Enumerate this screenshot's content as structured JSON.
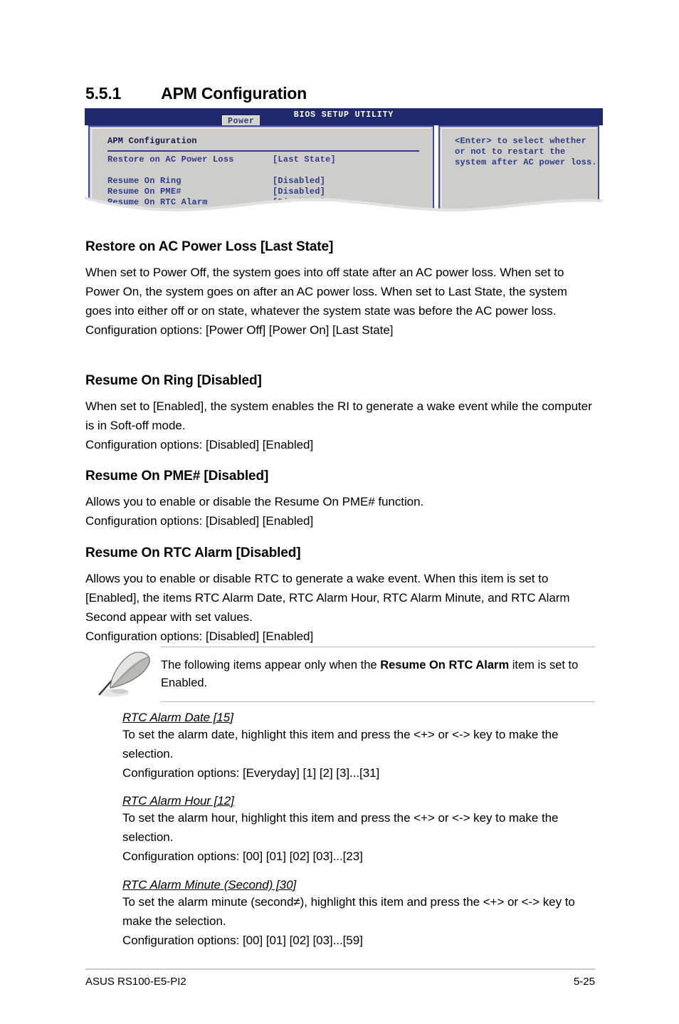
{
  "section": {
    "number": "5.5.1",
    "title": "APM Configuration"
  },
  "bios": {
    "title": "BIOS SETUP UTILITY",
    "tab": "Power",
    "panel_heading": "APM Configuration",
    "colors": {
      "header_blue": "#1f2a6e",
      "text_blue": "#2c3c8c",
      "panel_gray": "#cfcdca"
    },
    "rows": [
      {
        "label": "Restore on AC Power Loss",
        "value": "[Last State]"
      },
      {
        "label": "Resume On Ring",
        "value": "[Disabled]"
      },
      {
        "label": "Resume On PME#",
        "value": "[Disabled]"
      },
      {
        "label": "Resume On RTC Alarm",
        "value": "[Disabled]"
      }
    ],
    "help": "<Enter> to select whether or not to restart the system after AC power loss."
  },
  "items": [
    {
      "heading": "Restore on AC Power Loss [Last State]",
      "body": "When set to Power Off, the system goes into off state after an AC power loss. When set to Power On, the system goes on after an AC power loss. When set to Last State, the system goes into either off or on state, whatever the system state was before the AC power loss.",
      "options": "Configuration options: [Power Off] [Power On] [Last State]"
    },
    {
      "heading": "Resume On Ring [Disabled]",
      "body": "When set to [Enabled], the system enables the RI to generate a wake event while the computer is in Soft-off mode.",
      "options": "Configuration options: [Disabled] [Enabled]"
    },
    {
      "heading": "Resume On PME# [Disabled]",
      "body": "Allows you to enable or disable the Resume On PME# function.",
      "options": "Configuration options: [Disabled] [Enabled]"
    },
    {
      "heading": "Resume On RTC Alarm [Disabled]",
      "body": "Allows you to enable or disable RTC to generate a wake event. When this item is set to [Enabled], the items RTC Alarm Date, RTC Alarm Hour, RTC Alarm Minute, and RTC Alarm Second appear with set values.",
      "options": "Configuration options: [Disabled] [Enabled]"
    }
  ],
  "note": {
    "icon": "quill-pen-icon",
    "text_before": "The following items appear only when the ",
    "text_bold": "Resume On RTC Alarm",
    "text_after": " item is set to Enabled."
  },
  "subitems": [
    {
      "heading": "RTC Alarm Date [15]",
      "body": "To set the alarm date, highlight this item and press the <+> or <-> key to make the selection.",
      "options": "Configuration options: [Everyday] [1] [2] [3]...[31]"
    },
    {
      "heading": "RTC Alarm Hour [12] ",
      "body": "To set the alarm hour, highlight this item and press the <+> or <-> key to make the selection.",
      "options": "Configuration options: [00] [01] [02] [03]...[23]"
    },
    {
      "heading": "RTC Alarm Minute (Second) [30] ",
      "body": "To set the alarm minute (second≠), highlight this item and press the <+> or <-> key to make the selection.",
      "options": "Configuration options: [00] [01] [02] [03]...[59]"
    }
  ],
  "footer": {
    "product": "ASUS RS100-E5-PI2",
    "page": "5-25"
  }
}
